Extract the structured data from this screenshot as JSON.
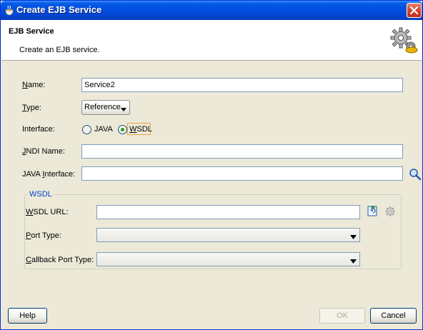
{
  "window": {
    "title": "Create EJB Service"
  },
  "header": {
    "title": "EJB Service",
    "subtitle": "Create an EJB service."
  },
  "form": {
    "name": {
      "label_first": "N",
      "label_rest": "ame:",
      "value": "Service2"
    },
    "type": {
      "label_first": "T",
      "label_rest": "ype:",
      "value": "Reference"
    },
    "interface": {
      "label": "Interface:",
      "options": [
        {
          "label": "JAVA",
          "selected": false
        },
        {
          "label_first": "W",
          "label_rest": "SDL",
          "selected": true
        }
      ]
    },
    "jndi_name": {
      "label_first": "J",
      "label_rest": "NDI Name:",
      "value": ""
    },
    "java_interface": {
      "label_pre": "JAVA ",
      "label_first": "I",
      "label_rest": "nterface:",
      "value": ""
    }
  },
  "wsdl_group": {
    "title": "WSDL",
    "wsdl_url": {
      "label_first": "W",
      "label_rest": "SDL URL:",
      "value": ""
    },
    "port_type": {
      "label_first": "P",
      "label_rest": "ort Type:",
      "value": ""
    },
    "callback_port_type": {
      "label_first": "C",
      "label_rest": "allback Port Type:",
      "value": ""
    }
  },
  "buttons": {
    "help": "Help",
    "ok": "OK",
    "cancel": "Cancel"
  },
  "colors": {
    "title_bar": "#0254e3",
    "dialog_bg": "#ece9d8",
    "accent_blue": "#0046d5",
    "radio_dot": "#21a121"
  }
}
